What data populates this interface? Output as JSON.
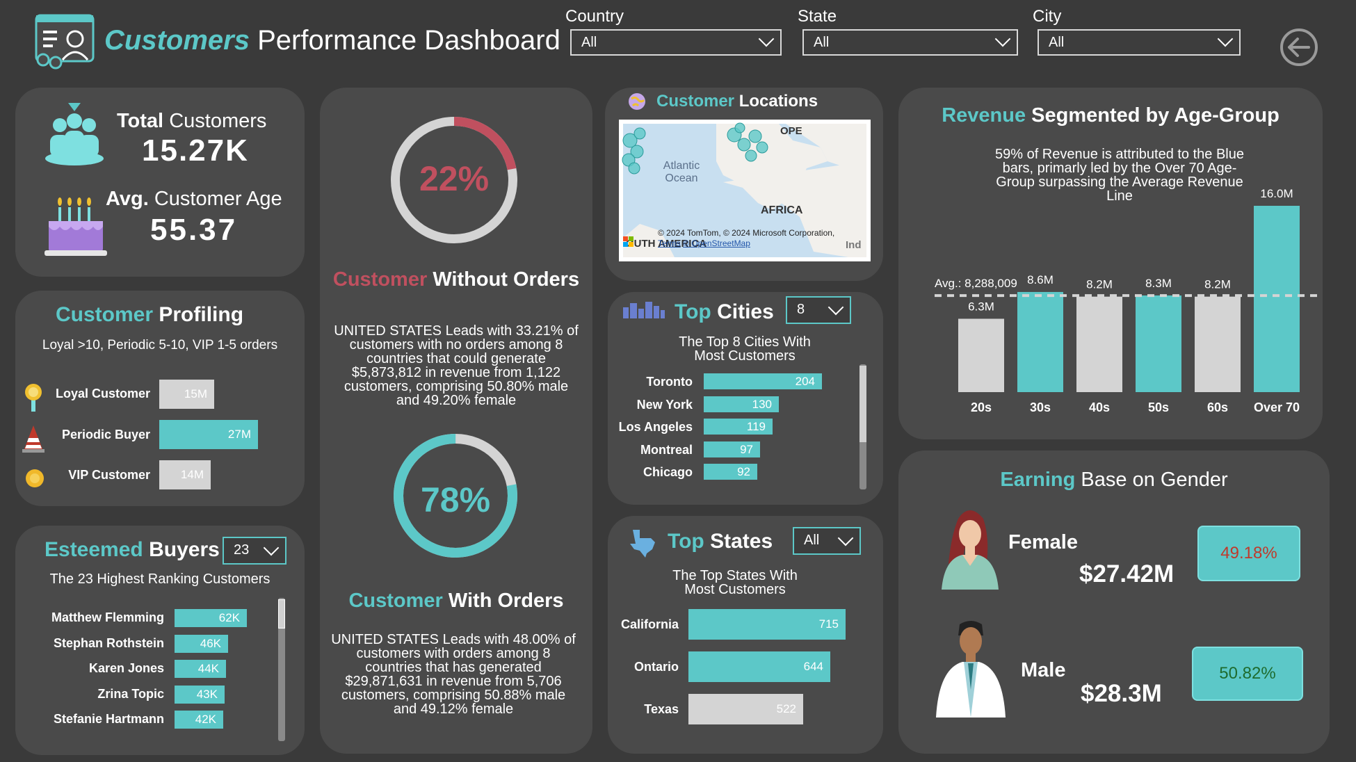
{
  "header": {
    "title_accent": "Customers",
    "title_rest": "Performance Dashboard",
    "filters": [
      {
        "label": "Country",
        "value": "All"
      },
      {
        "label": "State",
        "value": "All"
      },
      {
        "label": "City",
        "value": "All"
      }
    ]
  },
  "kpi": {
    "total_label_bold": "Total",
    "total_label_rest": "Customers",
    "total_value": "15.27K",
    "age_label_bold": "Avg.",
    "age_label_rest": "Customer Age",
    "age_value": "55.37"
  },
  "profiling": {
    "title_accent": "Customer",
    "title_rest": "Profiling",
    "subtitle": "Loyal >10, Periodic 5-10,  VIP 1-5 orders",
    "rows": [
      {
        "label": "Loyal Customer",
        "value": "15M",
        "num": 15,
        "color": "#d4d4d4"
      },
      {
        "label": "Periodic Buyer",
        "value": "27M",
        "num": 27,
        "color": "#5cc8c8"
      },
      {
        "label": "VIP Customer",
        "value": "14M",
        "num": 14,
        "color": "#d4d4d4"
      }
    ]
  },
  "esteemed": {
    "title_accent": "Esteemed",
    "title_rest": "Buyers",
    "filter_value": "23",
    "subtitle": "The 23 Highest Ranking Customers",
    "rows": [
      {
        "label": "Matthew Flemming",
        "value": "62K",
        "num": 62
      },
      {
        "label": "Stephan Rothstein",
        "value": "46K",
        "num": 46
      },
      {
        "label": "Karen Jones",
        "value": "44K",
        "num": 44
      },
      {
        "label": "Zrina Topic",
        "value": "43K",
        "num": 43
      },
      {
        "label": "Stefanie Hartmann",
        "value": "42K",
        "num": 42
      }
    ]
  },
  "orders": {
    "without_pct": "22%",
    "without_fraction": 0.22,
    "without_title_accent": "Customer",
    "without_title_rest": "Without Orders",
    "without_text": "UNITED STATES Leads with 33.21% of customers with no orders among 8 countries that could generate $5,873,812 in revenue from 1,122 customers, comprising 50.80% male and 49.20% female",
    "with_pct": "78%",
    "with_fraction": 0.78,
    "with_title_accent": "Customer",
    "with_title_rest": "With Orders",
    "with_text": "UNITED STATES Leads with 48.00% of customers with orders among 8 countries that has generated $29,871,631 in revenue from 5,706 customers, comprising 50.88% male and 49.12% female"
  },
  "locations": {
    "title_accent": "Customer",
    "title_rest": "Locations",
    "map_labels": {
      "ocean": "Atlantic Ocean",
      "africa": "AFRICA",
      "europe": "OPE",
      "south_america": "OUTH AMERICA",
      "india": "Ind"
    },
    "attribution": "© 2024 TomTom, © 2024 Microsoft Corporation,",
    "terms": "Terms",
    "osm": "© OpenStreetMap",
    "ms_logo": "Microsoft"
  },
  "cities": {
    "title_accent": "Top",
    "title_rest": "Cities",
    "filter_value": "8",
    "subtitle": "The Top 8 Cities With Most Customers",
    "rows": [
      {
        "label": "Toronto",
        "value": "204",
        "num": 204
      },
      {
        "label": "New York",
        "value": "130",
        "num": 130
      },
      {
        "label": "Los Angeles",
        "value": "119",
        "num": 119
      },
      {
        "label": "Montreal",
        "value": "97",
        "num": 97
      },
      {
        "label": "Chicago",
        "value": "92",
        "num": 92
      }
    ]
  },
  "states": {
    "title_accent": "Top",
    "title_rest": "States",
    "filter_value": "All",
    "subtitle": "The Top States With Most Customers",
    "rows": [
      {
        "label": "California",
        "value": "715",
        "num": 715,
        "color": "#5cc8c8"
      },
      {
        "label": "Ontario",
        "value": "644",
        "num": 644,
        "color": "#5cc8c8"
      },
      {
        "label": "Texas",
        "value": "522",
        "num": 522,
        "color": "#d4d4d4"
      }
    ]
  },
  "revenue": {
    "title_accent": "Revenue",
    "title_rest": "Segmented by Age-Group",
    "note": "59% of Revenue is attributed to the Blue bars, primarly led by the Over 70 Age-Group surpassing the Average Revenue Line",
    "avg_label": "Avg.: 8,288,009"
  },
  "chart_data": {
    "type": "bar",
    "categories": [
      "20s",
      "30s",
      "40s",
      "50s",
      "60s",
      "Over 70"
    ],
    "values": [
      6.3,
      8.6,
      8.2,
      8.3,
      8.2,
      16.0
    ],
    "value_labels": [
      "6.3M",
      "8.6M",
      "8.2M",
      "8.3M",
      "8.2M",
      "16.0M"
    ],
    "colors": [
      "#d4d4d4",
      "#5cc8c8",
      "#d4d4d4",
      "#5cc8c8",
      "#d4d4d4",
      "#5cc8c8"
    ],
    "average": 8.288009,
    "ylim": [
      0,
      16.0
    ],
    "title": "Revenue Segmented by Age-Group"
  },
  "gender": {
    "title_accent": "Earning",
    "title_rest": "Base on Gender",
    "female_label": "Female",
    "female_value": "$27.42M",
    "female_pct": "49.18%",
    "male_label": "Male",
    "male_value": "$28.3M",
    "male_pct": "50.82%",
    "colors": {
      "female_pct": "#c0392b",
      "male_pct": "#1e6b2e"
    }
  }
}
